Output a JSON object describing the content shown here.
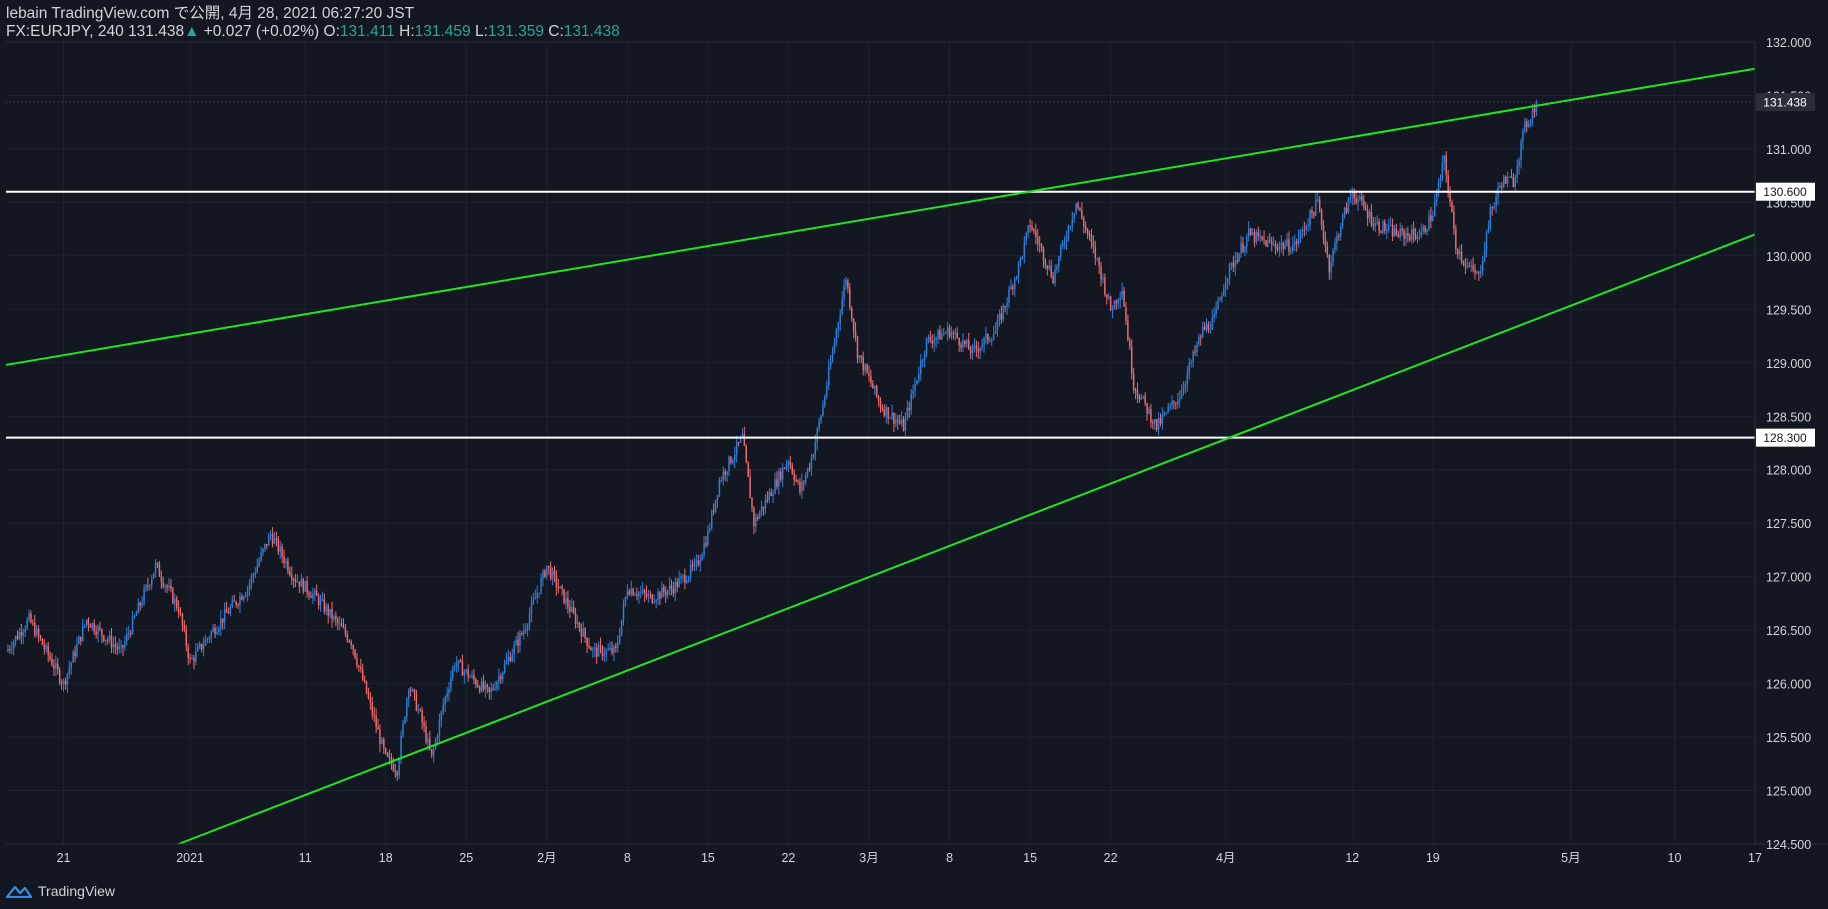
{
  "header": {
    "published": "lebain TradingView.com で公開, 4月 28, 2021 06:27:20 JST",
    "symbol": "FX:EURJPY, 240",
    "last": "131.438",
    "change_arrow": "▲",
    "change": "+0.027 (+0.02%)",
    "o_label": "O:",
    "o_value": "131.411",
    "h_label": "H:",
    "h_value": "131.459",
    "l_label": "L:",
    "l_value": "131.359",
    "c_label": "C:",
    "c_value": "131.438"
  },
  "footer": {
    "brand": "TradingView",
    "logo_icon": "tradingview-logo-icon"
  },
  "colors": {
    "background": "#131722",
    "grid": "#1e2230",
    "up": "#2f7fd8",
    "down": "#ef6a6a",
    "trendline": "#1fe61f",
    "level": "#ffffff",
    "text": "#d1d4dc",
    "accent": "#26a69a"
  },
  "chart_data": {
    "type": "candlestick",
    "symbol": "FX:EURJPY",
    "interval": "240",
    "x_range": [
      "2020-12-16",
      "2021-05-17"
    ],
    "ylim": [
      124.5,
      132.0
    ],
    "y_ticks": [
      132.0,
      131.5,
      131.0,
      130.5,
      130.0,
      129.5,
      129.0,
      128.5,
      128.0,
      127.5,
      127.0,
      126.5,
      126.0,
      125.5,
      125.0,
      124.5
    ],
    "y_tick_labels": [
      "132.000",
      "131.500",
      "131.000",
      "130.500",
      "130.000",
      "129.500",
      "129.000",
      "128.500",
      "128.000",
      "127.500",
      "127.000",
      "126.500",
      "126.000",
      "125.500",
      "125.000",
      "124.500"
    ],
    "x_ticks": [
      {
        "date": "2020-12-21",
        "label": "21"
      },
      {
        "date": "2021-01-01",
        "label": "2021"
      },
      {
        "date": "2021-01-11",
        "label": "11"
      },
      {
        "date": "2021-01-18",
        "label": "18"
      },
      {
        "date": "2021-01-25",
        "label": "25"
      },
      {
        "date": "2021-02-01",
        "label": "2月"
      },
      {
        "date": "2021-02-08",
        "label": "8"
      },
      {
        "date": "2021-02-15",
        "label": "15"
      },
      {
        "date": "2021-02-22",
        "label": "22"
      },
      {
        "date": "2021-03-01",
        "label": "3月"
      },
      {
        "date": "2021-03-08",
        "label": "8"
      },
      {
        "date": "2021-03-15",
        "label": "15"
      },
      {
        "date": "2021-03-22",
        "label": "22"
      },
      {
        "date": "2021-04-01",
        "label": "4月"
      },
      {
        "date": "2021-04-12",
        "label": "12"
      },
      {
        "date": "2021-04-19",
        "label": "19"
      },
      {
        "date": "2021-05-01",
        "label": "5月"
      },
      {
        "date": "2021-05-10",
        "label": "10"
      },
      {
        "date": "2021-05-17",
        "label": "17"
      }
    ],
    "price_path": [
      [
        "2020-12-16",
        126.3
      ],
      [
        "2020-12-18",
        126.6
      ],
      [
        "2020-12-21",
        126.0
      ],
      [
        "2020-12-23",
        126.6
      ],
      [
        "2020-12-26",
        126.3
      ],
      [
        "2020-12-29",
        127.1
      ],
      [
        "2020-12-31",
        126.7
      ],
      [
        "2021-01-01",
        126.2
      ],
      [
        "2021-01-03",
        126.5
      ],
      [
        "2021-01-06",
        126.9
      ],
      [
        "2021-01-08",
        127.4
      ],
      [
        "2021-01-09",
        127.2
      ],
      [
        "2021-01-10",
        127.0
      ],
      [
        "2021-01-12",
        126.8
      ],
      [
        "2021-01-15",
        126.4
      ],
      [
        "2021-01-18",
        125.3
      ],
      [
        "2021-01-19",
        125.2
      ],
      [
        "2021-01-20",
        126.0
      ],
      [
        "2021-01-21",
        125.7
      ],
      [
        "2021-01-22",
        125.3
      ],
      [
        "2021-01-23",
        125.8
      ],
      [
        "2021-01-24",
        126.2
      ],
      [
        "2021-01-27",
        125.9
      ],
      [
        "2021-01-28",
        126.1
      ],
      [
        "2021-01-30",
        126.5
      ],
      [
        "2021-02-01",
        127.1
      ],
      [
        "2021-02-03",
        126.7
      ],
      [
        "2021-02-05",
        126.3
      ],
      [
        "2021-02-07",
        126.3
      ],
      [
        "2021-02-08",
        126.9
      ],
      [
        "2021-02-10",
        126.8
      ],
      [
        "2021-02-12",
        126.9
      ],
      [
        "2021-02-14",
        127.1
      ],
      [
        "2021-02-15",
        127.4
      ],
      [
        "2021-02-16",
        127.9
      ],
      [
        "2021-02-18",
        128.3
      ],
      [
        "2021-02-19",
        127.5
      ],
      [
        "2021-02-21",
        127.9
      ],
      [
        "2021-02-22",
        128.1
      ],
      [
        "2021-02-23",
        127.8
      ],
      [
        "2021-02-24",
        128.1
      ],
      [
        "2021-02-25",
        128.6
      ],
      [
        "2021-02-27",
        129.8
      ],
      [
        "2021-02-28",
        129.1
      ],
      [
        "2021-03-02",
        128.6
      ],
      [
        "2021-03-04",
        128.4
      ],
      [
        "2021-03-06",
        129.2
      ],
      [
        "2021-03-08",
        129.3
      ],
      [
        "2021-03-10",
        129.1
      ],
      [
        "2021-03-12",
        129.3
      ],
      [
        "2021-03-14",
        129.9
      ],
      [
        "2021-03-15",
        130.3
      ],
      [
        "2021-03-17",
        129.8
      ],
      [
        "2021-03-19",
        130.5
      ],
      [
        "2021-03-21",
        129.9
      ],
      [
        "2021-03-22",
        129.5
      ],
      [
        "2021-03-23",
        129.7
      ],
      [
        "2021-03-24",
        128.8
      ],
      [
        "2021-03-26",
        128.4
      ],
      [
        "2021-03-28",
        128.7
      ],
      [
        "2021-03-30",
        129.3
      ],
      [
        "2021-03-31",
        129.4
      ],
      [
        "2021-04-01",
        129.8
      ],
      [
        "2021-04-03",
        130.2
      ],
      [
        "2021-04-05",
        130.1
      ],
      [
        "2021-04-07",
        130.1
      ],
      [
        "2021-04-09",
        130.5
      ],
      [
        "2021-04-10",
        129.9
      ],
      [
        "2021-04-11",
        130.3
      ],
      [
        "2021-04-12",
        130.6
      ],
      [
        "2021-04-14",
        130.3
      ],
      [
        "2021-04-16",
        130.2
      ],
      [
        "2021-04-18",
        130.2
      ],
      [
        "2021-04-19",
        130.4
      ],
      [
        "2021-04-20",
        130.9
      ],
      [
        "2021-04-21",
        130.1
      ],
      [
        "2021-04-22",
        129.9
      ],
      [
        "2021-04-23",
        129.8
      ],
      [
        "2021-04-24",
        130.4
      ],
      [
        "2021-04-25",
        130.7
      ],
      [
        "2021-04-26",
        130.7
      ],
      [
        "2021-04-27",
        131.2
      ],
      [
        "2021-04-28",
        131.438
      ]
    ],
    "horizontal_levels": [
      {
        "value": 130.6,
        "label": "130.600",
        "color": "#ffffff"
      },
      {
        "value": 128.3,
        "label": "128.300",
        "color": "#ffffff"
      }
    ],
    "trend_lines": [
      {
        "name": "upper",
        "color": "#1fe61f",
        "points": [
          [
            "2020-12-16",
            128.98
          ],
          [
            "2021-05-17",
            131.75
          ]
        ]
      },
      {
        "name": "lower",
        "color": "#1fe61f",
        "points": [
          [
            "2020-12-31",
            124.5
          ],
          [
            "2021-05-17",
            130.2
          ]
        ]
      }
    ],
    "last_price": {
      "value": 131.438,
      "label": "131.438"
    }
  }
}
